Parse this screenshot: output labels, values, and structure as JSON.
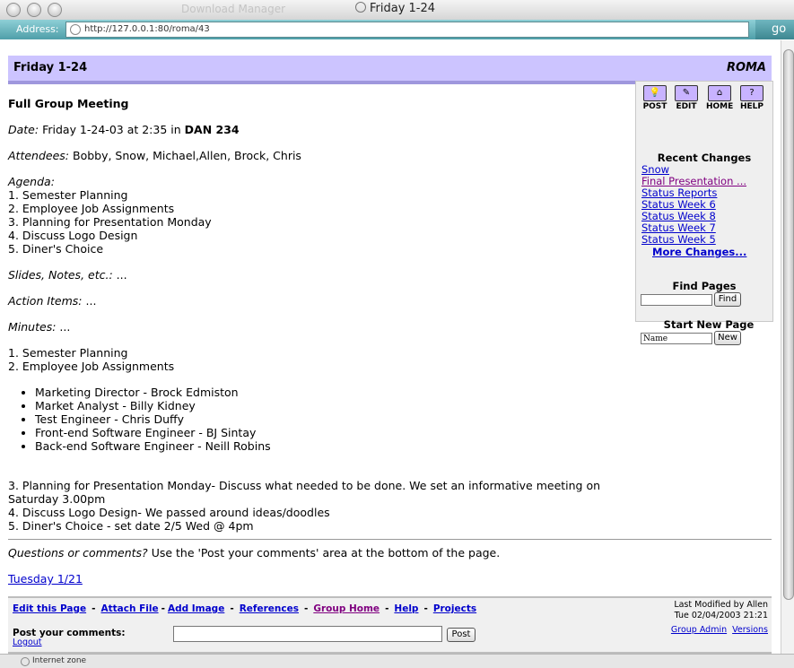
{
  "window": {
    "ghost_title": "Download Manager",
    "title": "Friday 1-24",
    "address_label": "Address:",
    "url": "http://127.0.0.1:80/roma/43",
    "go_label": "go",
    "status_text": "Internet zone"
  },
  "page": {
    "header_title": "Friday 1-24",
    "brand": "ROMA",
    "heading": "Full Group Meeting",
    "date_label": "Date:",
    "date_text": "Friday 1-24-03 at 2:35 in",
    "date_room": "DAN 234",
    "attendees_label": "Attendees:",
    "attendees": "Bobby, Snow, Michael,Allen, Brock, Chris",
    "agenda_label": "Agenda:",
    "agenda": [
      "1. Semester Planning",
      "2. Employee Job Assignments",
      "3. Planning for Presentation Monday",
      "4. Discuss Logo Design",
      "5. Diner's Choice"
    ],
    "slides_label": "Slides, Notes, etc.:",
    "slides_value": "...",
    "action_label": "Action Items:",
    "action_value": "...",
    "minutes_label": "Minutes:",
    "minutes_value": "...",
    "minutes_items": [
      "1. Semester Planning",
      "2. Employee Job Assignments"
    ],
    "assignments": [
      "Marketing Director - Brock Edmiston",
      "Market Analyst - Billy Kidney",
      "Test Engineer - Chris Duffy",
      "Front-end Software Engineer - BJ Sintay",
      "Back-end Software Engineer - Neill Robins"
    ],
    "minutes_rest": [
      "3. Planning for Presentation Monday- Discuss what needed to be done. We set an informative meeting on Saturday 3.00pm",
      "4. Discuss Logo Design- We passed around ideas/doodles",
      "5. Diner's Choice - set date 2/5 Wed @ 4pm"
    ],
    "questions_label": "Questions or comments?",
    "questions_text": "Use the 'Post your comments' area at the bottom of the page.",
    "prev_link": "Tuesday 1/21"
  },
  "sidebar": {
    "tools": [
      {
        "label": "POST",
        "icon": "lightbulb-icon",
        "glyph": "💡"
      },
      {
        "label": "EDIT",
        "icon": "pencil-icon",
        "glyph": "✎"
      },
      {
        "label": "HOME",
        "icon": "house-icon",
        "glyph": "⌂"
      },
      {
        "label": "HELP",
        "icon": "question-icon",
        "glyph": "?"
      }
    ],
    "recent_title": "Recent Changes",
    "recent": [
      "Snow",
      "Final Presentation ...",
      "Status Reports",
      "Status Week 6",
      "Status Week 8",
      "Status Week 7",
      "Status Week 5"
    ],
    "more_changes": "More Changes...",
    "find_title": "Find Pages",
    "find_button": "Find",
    "start_title": "Start New Page",
    "start_value": "Name",
    "new_button": "New"
  },
  "footer": {
    "links": [
      "Edit this Page",
      "Attach File",
      "Add Image",
      "References",
      "Group Home",
      "Help",
      "Projects"
    ],
    "last_modified": "Last Modified by Allen",
    "modified_date": "Tue 02/04/2003 21:21",
    "group_admin": "Group Admin",
    "versions": "Versions",
    "post_label": "Post your comments:",
    "logout": "Logout",
    "post_button": "Post"
  },
  "colors": {
    "header_bg": "#ccc4ff",
    "link": "#0000cc",
    "visited": "#800080"
  }
}
